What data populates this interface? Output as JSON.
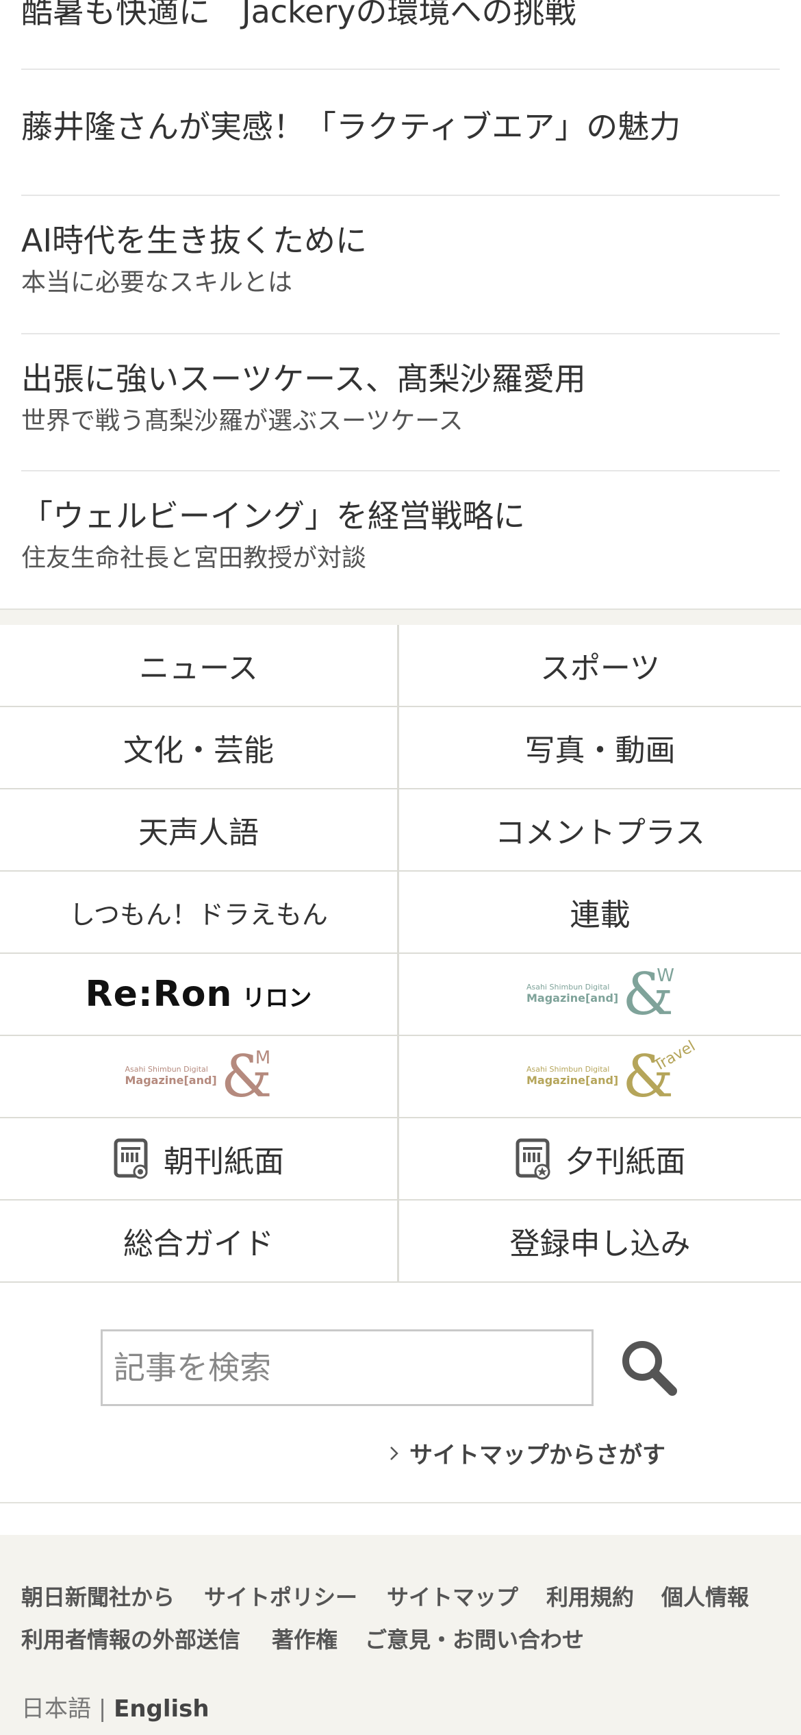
{
  "articles": [
    {
      "title": "酷暑も快適に　Jackeryの環境への挑戦",
      "subtitle": ""
    },
    {
      "title": "藤井隆さんが実感！「ラクティブエア」の魅力",
      "subtitle": ""
    },
    {
      "title": "AI時代を生き抜くために",
      "subtitle": "本当に必要なスキルとは"
    },
    {
      "title": "出張に強いスーツケース、髙梨沙羅愛用",
      "subtitle": "世界で戦う髙梨沙羅が選ぶスーツケース"
    },
    {
      "title": "「ウェルビーイング」を経営戦略に",
      "subtitle": "住友生命社長と宮田教授が対談"
    }
  ],
  "nav": {
    "news": "ニュース",
    "sports": "スポーツ",
    "culture": "文化・芸能",
    "photo_video": "写真・動画",
    "tensei": "天声人語",
    "comment_plus": "コメントプラス",
    "shitsumon": "しつもん！ドラえもん",
    "rensai": "連載",
    "reron_word": "Re:Ron",
    "reron_kana": "リロン",
    "and_w": {
      "line1": "Asahi Shimbun Digital",
      "line2": "Magazine[and]",
      "amp": "&",
      "suffix": "W",
      "color": "#7fa39a"
    },
    "and_m": {
      "line1": "Asahi Shimbun Digital",
      "line2": "Magazine[and]",
      "amp": "&",
      "suffix": "M",
      "color": "#b58a7e"
    },
    "and_travel": {
      "line1": "Asahi Shimbun Digital",
      "line2": "Magazine[and]",
      "amp": "&",
      "suffix": "Travel",
      "color": "#b5a55a"
    },
    "morning_paper": "朝刊紙面",
    "evening_paper": "夕刊紙面",
    "guide": "総合ガイド",
    "register": "登録申し込み"
  },
  "search": {
    "placeholder": "記事を検索",
    "sitemap_link": "サイトマップからさがす"
  },
  "footer": {
    "links": [
      "朝日新聞社から",
      "サイトポリシー",
      "サイトマップ",
      "利用規約",
      "個人情報",
      "利用者情報の外部送信",
      "著作権",
      "ご意見・お問い合わせ"
    ],
    "lang_ja": "日本語",
    "lang_sep": "|",
    "lang_en": "English"
  }
}
